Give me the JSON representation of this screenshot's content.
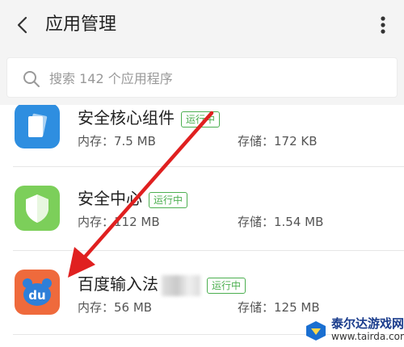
{
  "header": {
    "title": "应用管理",
    "back_icon": "chevron-left-icon",
    "more_icon": "more-vertical-icon"
  },
  "search": {
    "placeholder": "搜索 142 个应用程序",
    "icon": "search-icon"
  },
  "apps": [
    {
      "name": "安全核心组件",
      "status": "运行中",
      "memory": "内存：7.5 MB",
      "storage": "存储：172 KB",
      "icon": "phone-device-icon",
      "icon_color": "#2e8ee0"
    },
    {
      "name": "安全中心",
      "status": "运行中",
      "memory": "内存：112 MB",
      "storage": "存储：1.54 MB",
      "icon": "shield-icon",
      "icon_color": "#7ccf5a"
    },
    {
      "name": "百度输入法",
      "status": "运行中",
      "memory": "内存：56 MB",
      "storage": "存储：125 MB",
      "icon": "baidu-input-icon",
      "icon_color": "#ef6a3c"
    }
  ],
  "watermark": {
    "text": "泰尔达游戏网",
    "url": "www.tairda.com"
  },
  "colors": {
    "header_bg": "#f4f4f4",
    "status_green": "#4caf50",
    "arrow_red": "#e02020"
  }
}
